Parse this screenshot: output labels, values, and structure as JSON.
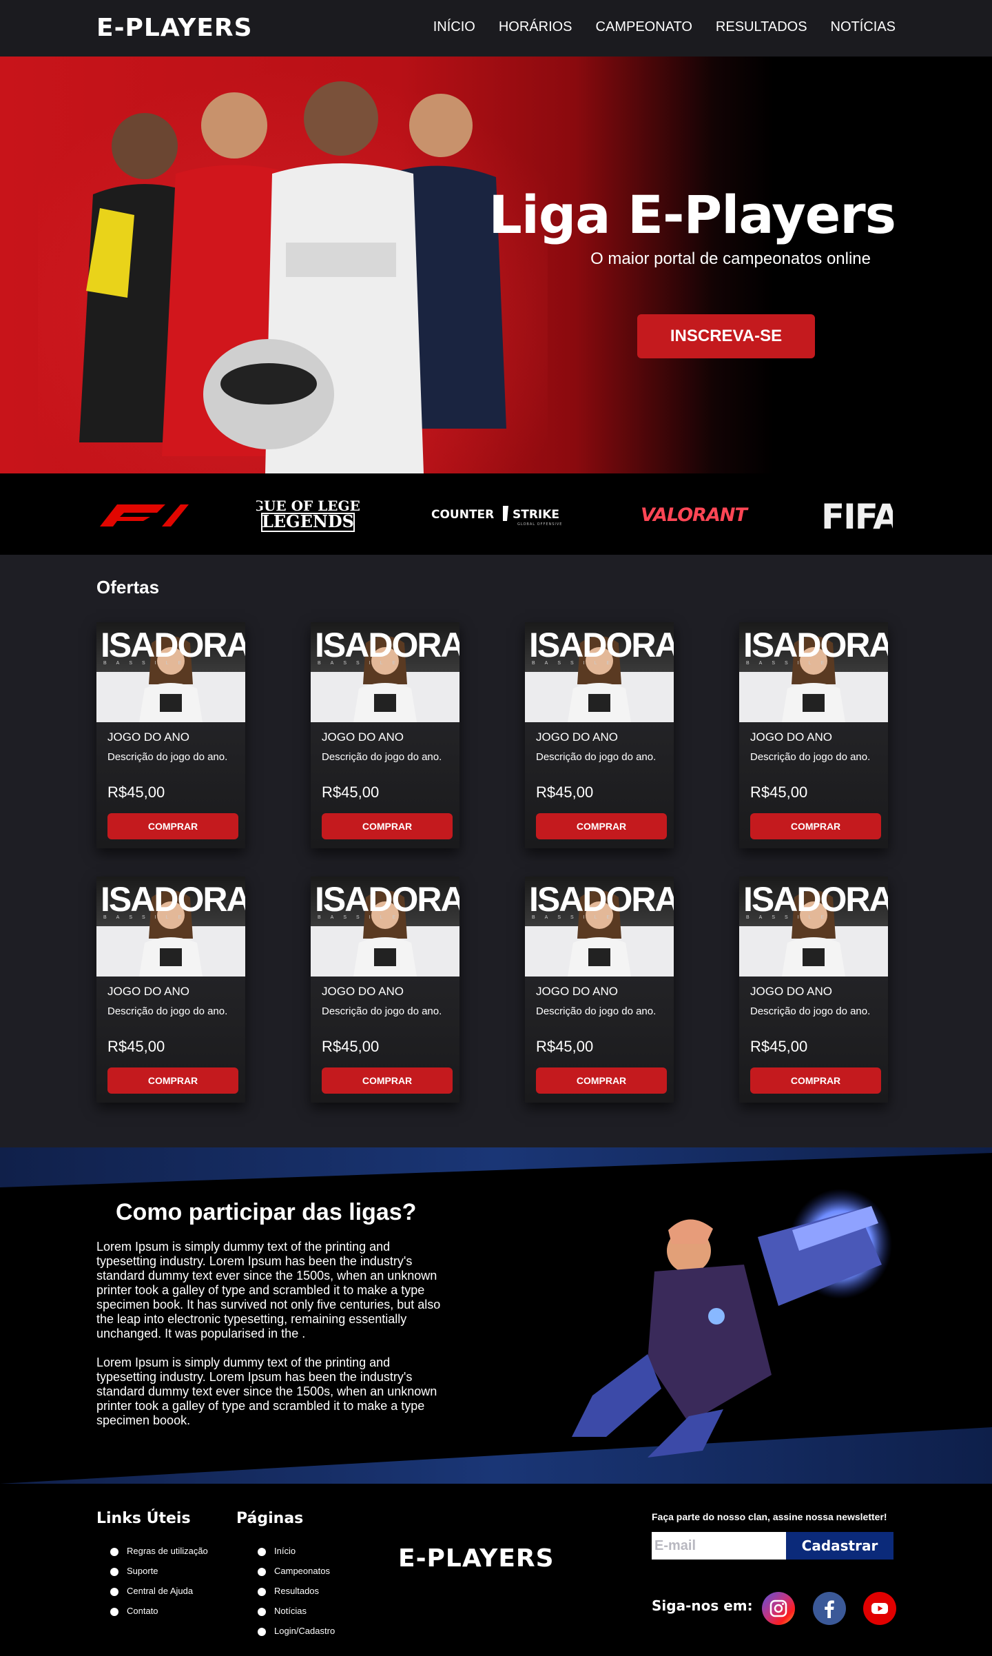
{
  "nav": {
    "logo": "E-PLAYERS",
    "links": [
      "INÍCIO",
      "HORÁRIOS",
      "CAMPEONATO",
      "RESULTADOS",
      "NOTÍCIAS"
    ]
  },
  "hero": {
    "title": "Liga E-Players",
    "subtitle": "O maior portal de campeonatos online",
    "cta": "INSCREVA-SE"
  },
  "games": [
    "F1",
    "LEAGUE OF LEGENDS",
    "COUNTER STRIKE",
    "VALORANT",
    "FIFA"
  ],
  "offers": {
    "title": "Ofertas",
    "card_image_name": "ISADORA",
    "card_image_sub": "BASSILE",
    "cards": [
      {
        "title": "JOGO DO ANO",
        "desc": "Descrição do jogo do ano.",
        "price": "R$45,00",
        "button": "COMPRAR"
      },
      {
        "title": "JOGO DO ANO",
        "desc": "Descrição do jogo do ano.",
        "price": "R$45,00",
        "button": "COMPRAR"
      },
      {
        "title": "JOGO DO ANO",
        "desc": "Descrição do jogo do ano.",
        "price": "R$45,00",
        "button": "COMPRAR"
      },
      {
        "title": "JOGO DO ANO",
        "desc": "Descrição do jogo do ano.",
        "price": "R$45,00",
        "button": "COMPRAR"
      },
      {
        "title": "JOGO DO ANO",
        "desc": "Descrição do jogo do ano.",
        "price": "R$45,00",
        "button": "COMPRAR"
      },
      {
        "title": "JOGO DO ANO",
        "desc": "Descrição do jogo do ano.",
        "price": "R$45,00",
        "button": "COMPRAR"
      },
      {
        "title": "JOGO DO ANO",
        "desc": "Descrição do jogo do ano.",
        "price": "R$45,00",
        "button": "COMPRAR"
      },
      {
        "title": "JOGO DO ANO",
        "desc": "Descrição do jogo do ano.",
        "price": "R$45,00",
        "button": "COMPRAR"
      }
    ]
  },
  "howto": {
    "title": "Como participar das ligas?",
    "p1": "Lorem Ipsum is simply dummy text of the printing and typesetting industry. Lorem Ipsum has been the industry's standard dummy text ever since the 1500s, when an unknown printer took a galley of type and scrambled it to make a type specimen book. It has survived not only five centuries, but also the leap into electronic typesetting, remaining essentially unchanged. It was popularised in the .",
    "p2": "Lorem Ipsum is simply dummy text of the printing and typesetting industry. Lorem Ipsum has been the industry's standard dummy text ever since the 1500s, when an unknown printer took a galley of type and scrambled it to make a type specimen boook."
  },
  "footer": {
    "links_title": "Links Úteis",
    "links": [
      "Regras de utilização",
      "Suporte",
      "Central de Ajuda",
      "Contato"
    ],
    "pages_title": "Páginas",
    "pages": [
      "Início",
      "Campeonatos",
      "Resultados",
      "Notícias",
      "Login/Cadastro"
    ],
    "logo": "E-PLAYERS",
    "newsletter_text": "Faça parte do nosso clan, assine nossa newsletter!",
    "email_placeholder": "E-mail",
    "subscribe_label": "Cadastrar",
    "follow_label": "Siga-nos em:",
    "socials": [
      "instagram-icon",
      "facebook-icon",
      "youtube-icon"
    ]
  },
  "colors": {
    "accent_red": "#c41a1e",
    "subscribe_blue": "#0b2a7a",
    "background": "#1e1e24"
  }
}
